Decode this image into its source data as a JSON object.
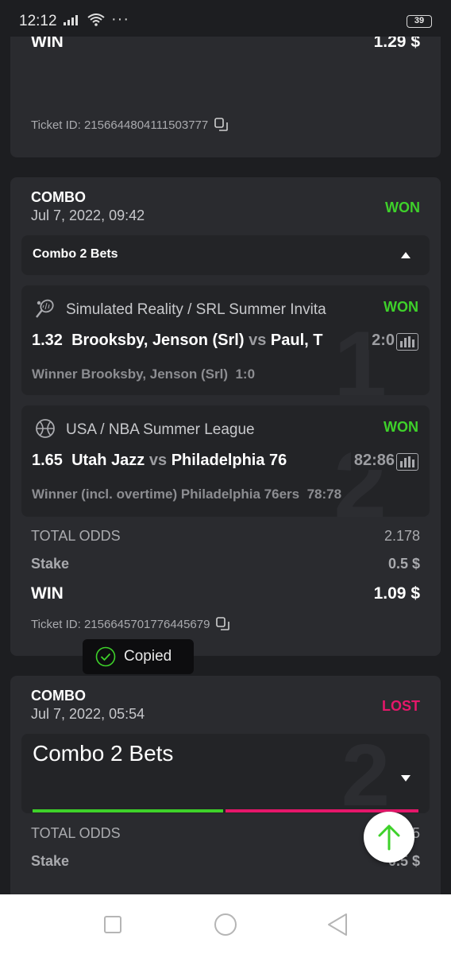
{
  "status_bar": {
    "time": "12:12",
    "dots": "···",
    "battery": "39"
  },
  "top_card": {
    "win_label": "WIN",
    "win_value": "1.29 $",
    "ticket": "Ticket ID: 2156644804111503777"
  },
  "combo1": {
    "title": "COMBO",
    "date": "Jul 7, 2022, 09:42",
    "status": "WON",
    "bar_label": "Combo 2 Bets",
    "bets": [
      {
        "number": "1",
        "league": "Simulated Reality / SRL Summer Invita",
        "status": "WON",
        "odds": "1.32",
        "home": "Brooksby, Jenson (Srl)",
        "vs": "vs",
        "away": "Paul, T",
        "score": "2:0",
        "market": "Winner Brooksby, Jenson (Srl)",
        "result": "1:0"
      },
      {
        "number": "2",
        "league": "USA / NBA Summer League",
        "status": "WON",
        "odds": "1.65",
        "home": "Utah Jazz",
        "vs": "vs",
        "away": "Philadelphia 76",
        "score": "82:86",
        "market": "Winner (incl. overtime) Philadelphia 76ers",
        "result": "78:78"
      }
    ],
    "total_odds_label": "TOTAL ODDS",
    "total_odds": "2.178",
    "stake_label": "Stake",
    "stake": "0.5 $",
    "win_label": "WIN",
    "win_value": "1.09 $",
    "ticket": "Ticket ID: 2156645701776445679"
  },
  "toast": {
    "text": "Copied"
  },
  "combo2": {
    "title": "COMBO",
    "date": "Jul 7, 2022, 05:54",
    "status": "LOST",
    "bar_label": "Combo 2 Bets",
    "big_number": "2",
    "total_odds_label": "TOTAL ODDS",
    "total_odds_partial": "5",
    "stake_label": "Stake",
    "stake_partial": "0.5 $"
  },
  "colors": {
    "won": "#3ed12a",
    "lost": "#e5176a",
    "background": "#1d1e21",
    "card": "#2a2b2f"
  },
  "icons": {
    "tennis": "tennis-icon",
    "basketball": "basketball-icon",
    "copy": "copy-icon",
    "stats": "stats-icon",
    "arrow_up": "arrow-up-icon",
    "check": "check-circle-icon"
  }
}
